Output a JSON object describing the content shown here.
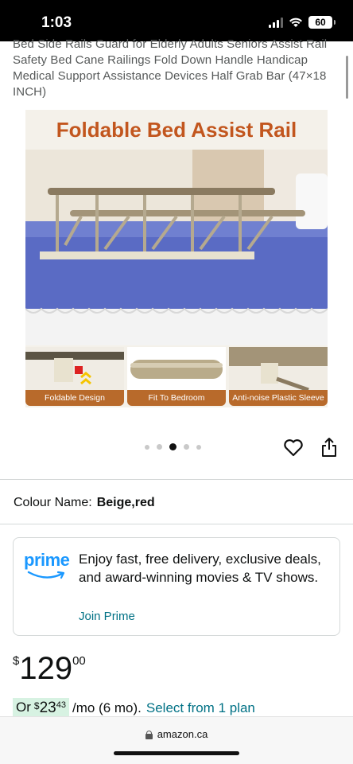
{
  "status_bar": {
    "time": "1:03",
    "battery": "60"
  },
  "product": {
    "title": "Bed Side Rails Guard for Elderly Adults Seniors Assist Rail Safety Bed Cane Railings Fold Down Handle Handicap Medical Support Assistance Devices Half Grab Bar (47×18 INCH)"
  },
  "image": {
    "headline": "Foldable Bed Assist Rail",
    "captions": [
      "Foldable Design",
      "Fit To Bedroom",
      "Anti-noise Plastic Sleeve"
    ]
  },
  "colour": {
    "label": "Colour Name:",
    "value": "Beige,red"
  },
  "prime": {
    "logo_text": "prime",
    "text": "Enjoy fast, free delivery, exclusive deals, and award-winning movies & TV shows.",
    "link": "Join Prime"
  },
  "price": {
    "currency": "$",
    "whole": "129",
    "fraction": "00"
  },
  "installment": {
    "prefix": "Or",
    "currency": "$",
    "whole": "23",
    "fraction": "43",
    "period": "/mo (6 mo).",
    "link": "Select from 1 plan"
  },
  "browser": {
    "url": "amazon.ca"
  },
  "colors": {
    "link": "#007185",
    "prime_blue": "#1a98ff",
    "installment_bg": "#d7f2e2"
  }
}
